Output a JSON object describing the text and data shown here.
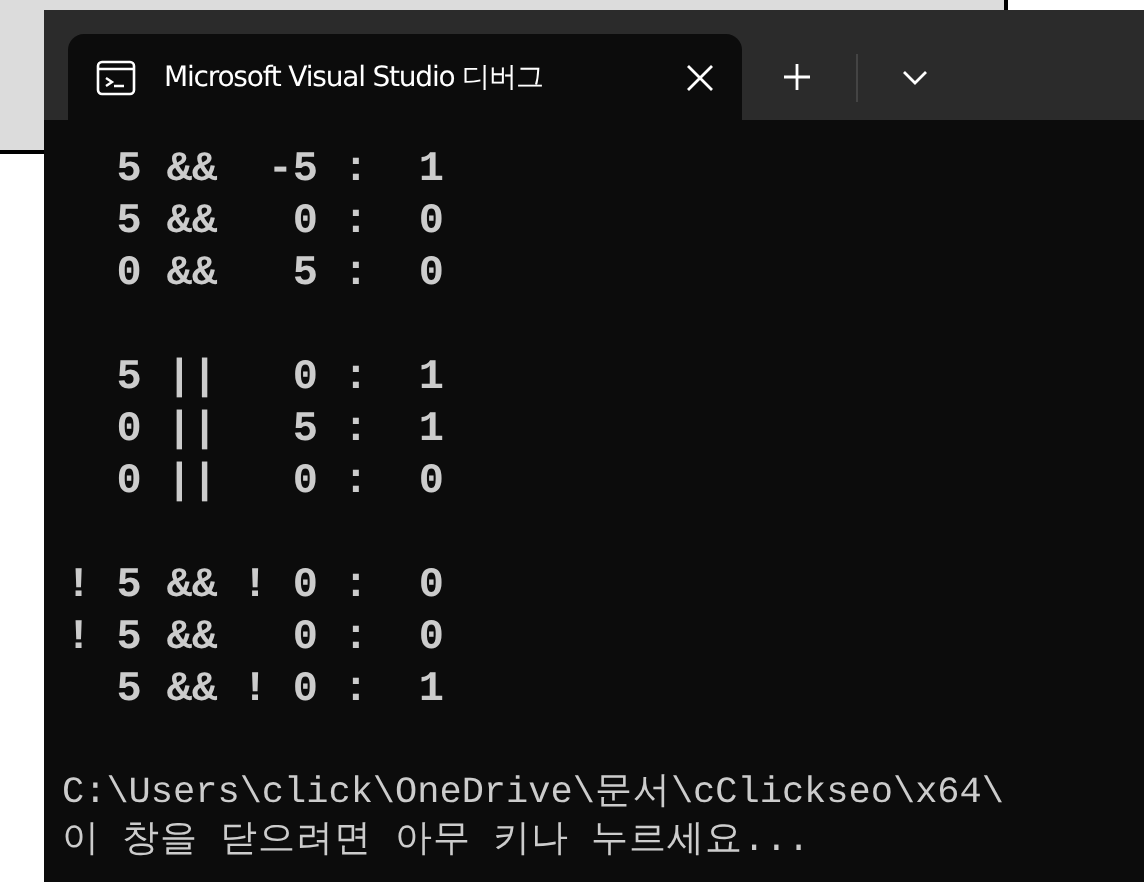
{
  "tab": {
    "title": "Microsoft Visual Studio 디버그",
    "selected": true
  },
  "output_blocks": [
    {
      "lines": [
        "  5 &&  -5 :  1",
        "  5 &&   0 :  0",
        "  0 &&   5 :  0"
      ]
    },
    {
      "lines": [
        "  5 ||   0 :  1",
        "  0 ||   5 :  1",
        "  0 ||   0 :  0"
      ]
    },
    {
      "lines": [
        "! 5 && ! 0 :  0",
        "! 5 &&   0 :  0",
        "  5 && ! 0 :  1"
      ]
    },
    {
      "lines": [
        "C:\\Users\\click\\OneDrive\\문서\\cClickseo\\x64\\",
        "이 창을 닫으려면 아무 키나 누르세요..."
      ],
      "kind": "prompt"
    }
  ]
}
